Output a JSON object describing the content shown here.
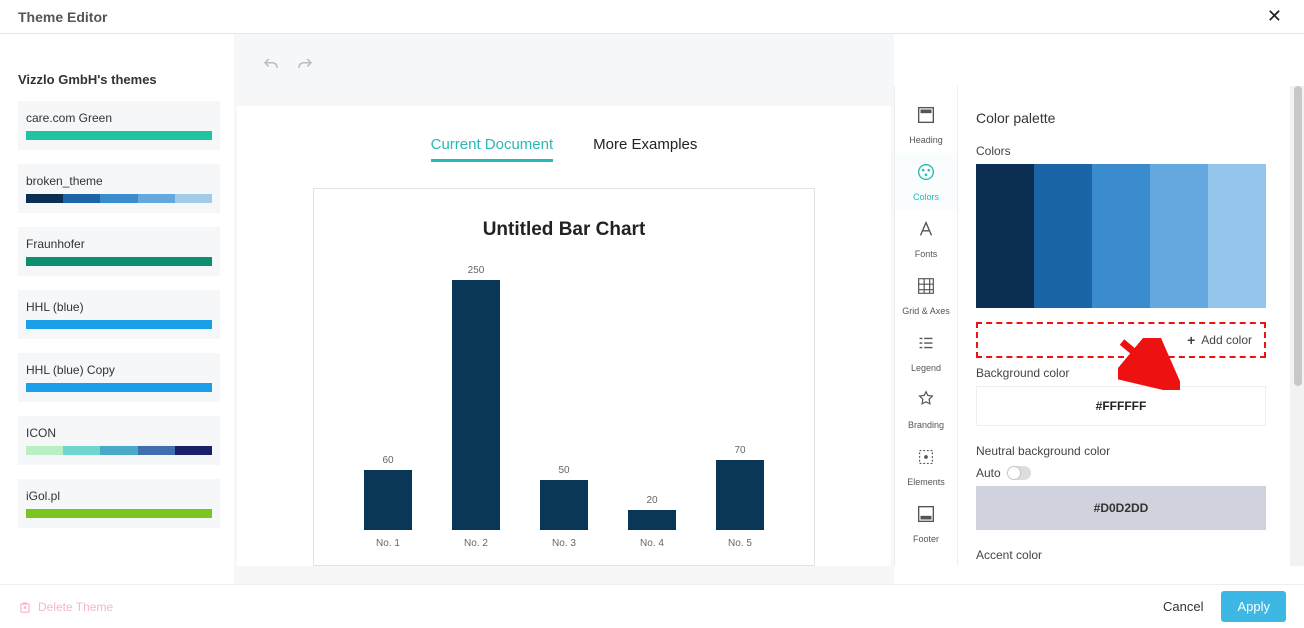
{
  "header": {
    "title": "Theme Editor"
  },
  "sidebar": {
    "heading": "Vizzlo GmbH's themes",
    "themes": [
      {
        "name": "care.com Green",
        "colors": [
          "#1fc4a3",
          "#1fc4a3",
          "#1fc4a3",
          "#1fc4a3",
          "#1fc4a3"
        ]
      },
      {
        "name": "broken_theme",
        "colors": [
          "#0a2f52",
          "#1b65a6",
          "#3b8bcf",
          "#63a9df",
          "#a1cbe9"
        ]
      },
      {
        "name": "Fraunhofer",
        "colors": [
          "#0c8f6f",
          "#0c8f6f",
          "#0c8f6f",
          "#0c8f6f",
          "#0c8f6f"
        ]
      },
      {
        "name": "HHL (blue)",
        "colors": [
          "#1a9fe8",
          "#1a9fe8",
          "#1a9fe8",
          "#1a9fe8",
          "#1a9fe8"
        ]
      },
      {
        "name": "HHL (blue) Copy",
        "colors": [
          "#1a9fe8",
          "#1a9fe8",
          "#1a9fe8",
          "#1a9fe8",
          "#1a9fe8"
        ]
      },
      {
        "name": "ICON",
        "colors": [
          "#b9efc2",
          "#6fd6cf",
          "#4aa9c9",
          "#3f6fae",
          "#1a1f6a"
        ]
      },
      {
        "name": "iGol.pl",
        "colors": [
          "#7ac51e",
          "#7ac51e",
          "#7ac51e",
          "#7ac51e",
          "#7ac51e"
        ]
      }
    ]
  },
  "tabs": {
    "current": "Current Document",
    "more": "More Examples"
  },
  "chart_data": {
    "type": "bar",
    "title": "Untitled Bar Chart",
    "categories": [
      "No. 1",
      "No. 2",
      "No. 3",
      "No. 4",
      "No. 5"
    ],
    "values": [
      60,
      250,
      50,
      20,
      70
    ],
    "xlabel": "",
    "ylabel": "",
    "ylim": [
      0,
      260
    ]
  },
  "props": {
    "items": [
      {
        "icon": "heading-icon",
        "label": "Heading"
      },
      {
        "icon": "colors-icon",
        "label": "Colors"
      },
      {
        "icon": "fonts-icon",
        "label": "Fonts"
      },
      {
        "icon": "grid-icon",
        "label": "Grid & Axes"
      },
      {
        "icon": "legend-icon",
        "label": "Legend"
      },
      {
        "icon": "branding-icon",
        "label": "Branding"
      },
      {
        "icon": "elements-icon",
        "label": "Elements"
      },
      {
        "icon": "footer-icon",
        "label": "Footer"
      }
    ],
    "active_index": 1
  },
  "panel": {
    "section_title": "Color palette",
    "colors_label": "Colors",
    "palette": [
      "#0a2f52",
      "#1b65a6",
      "#3b8bcf",
      "#63a9df",
      "#94c6ec"
    ],
    "add_color": "Add color",
    "bg_label": "Background color",
    "bg_value": "#FFFFFF",
    "neutral_label": "Neutral background color",
    "auto_label": "Auto",
    "neutral_value": "#D0D2DD",
    "accent_label": "Accent color"
  },
  "footer": {
    "delete": "Delete Theme",
    "cancel": "Cancel",
    "apply": "Apply"
  }
}
